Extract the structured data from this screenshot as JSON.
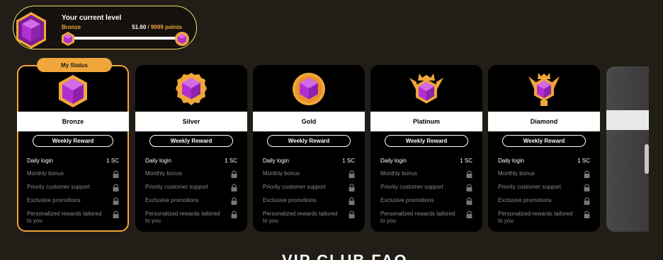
{
  "level": {
    "title": "Your current level",
    "tier": "Bronze",
    "points_current": "51.60",
    "points_max": " / 9999 points",
    "progress": 0.005
  },
  "status_tag": "My Status",
  "cards": [
    {
      "name": "Bronze",
      "reward": "Weekly Reward",
      "perks": [
        {
          "label": "Daily login",
          "value": "1 SC"
        },
        {
          "label": "Monthly bonus",
          "value": ""
        },
        {
          "label": "Priority customer support",
          "value": ""
        },
        {
          "label": "Exclusive promotions",
          "value": ""
        },
        {
          "label": "Personalized rewards tailored to you",
          "value": ""
        }
      ]
    },
    {
      "name": "Silver",
      "reward": "Weekly Reward",
      "perks": [
        {
          "label": "Daily login",
          "value": "1 SC"
        },
        {
          "label": "Monthly bonus",
          "value": ""
        },
        {
          "label": "Priority customer support",
          "value": ""
        },
        {
          "label": "Exclusive promotions",
          "value": ""
        },
        {
          "label": "Personalized rewards tailored to you",
          "value": ""
        }
      ]
    },
    {
      "name": "Gold",
      "reward": "Weekly Reward",
      "perks": [
        {
          "label": "Daily login",
          "value": "1 SC"
        },
        {
          "label": "Monthly bonus",
          "value": ""
        },
        {
          "label": "Priority customer support",
          "value": ""
        },
        {
          "label": "Exclusive promotions",
          "value": ""
        },
        {
          "label": "Personalized rewards tailored to you",
          "value": ""
        }
      ]
    },
    {
      "name": "Platinum",
      "reward": "Weekly Reward",
      "perks": [
        {
          "label": "Daily login",
          "value": "1 SC"
        },
        {
          "label": "Monthly bonus",
          "value": ""
        },
        {
          "label": "Priority customer support",
          "value": ""
        },
        {
          "label": "Exclusive promotions",
          "value": ""
        },
        {
          "label": "Personalized rewards tailored to you",
          "value": ""
        }
      ]
    },
    {
      "name": "Diamond",
      "reward": "Weekly Reward",
      "perks": [
        {
          "label": "Daily login",
          "value": "1 SC"
        },
        {
          "label": "Monthly bonus",
          "value": ""
        },
        {
          "label": "Priority customer support",
          "value": ""
        },
        {
          "label": "Exclusive promotions",
          "value": ""
        },
        {
          "label": "Personalized rewards tailored to you",
          "value": ""
        }
      ]
    }
  ],
  "faq_heading": "VIP CLUB FAQ",
  "colors": {
    "accent": "#f0a63a",
    "border_glow": "#f0e36a",
    "gem": "#b12fd1",
    "background": "#231d17"
  }
}
